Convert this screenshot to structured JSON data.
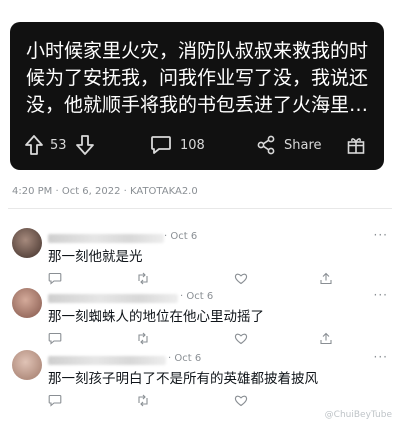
{
  "post": {
    "text": "小时候家里火灾，消防队叔叔来救我的时候为了安抚我，问我作业写了没，我说还没，他就顺手将我的书包丢进了火海里…",
    "upvote_count": "53",
    "comment_count": "108",
    "share_label": "Share"
  },
  "meta": {
    "time": "4:20 PM · Oct 6, 2022 · KATOTAKA2.0"
  },
  "replies": [
    {
      "date": "· Oct 6",
      "text": "那一刻他就是光",
      "more": "···",
      "avatar_color": "#8a6d5f"
    },
    {
      "date": "· Oct 6",
      "text": "那一刻蜘蛛人的地位在他心里动摇了",
      "more": "···",
      "avatar_color": "#b88979"
    },
    {
      "date": "· Oct 6",
      "text": "那一刻孩子明白了不是所有的英雄都披着披风",
      "more": "···",
      "avatar_color": "#c9a79a"
    }
  ],
  "watermark": "@ChuiBeyTube",
  "colors": {
    "card_bg": "#111111",
    "card_text": "#ffffff",
    "muted": "#8a8f94"
  }
}
